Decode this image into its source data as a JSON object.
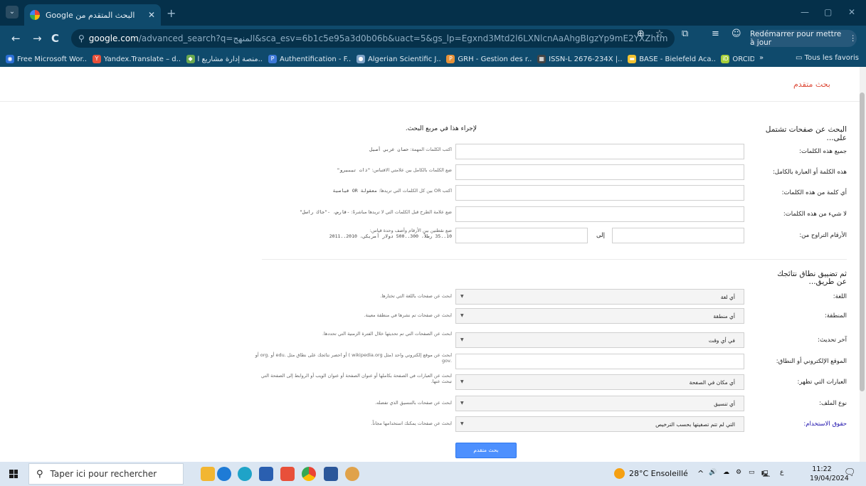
{
  "browser": {
    "tab_title": "البحث المتقدم من Google",
    "tab_close": "✕",
    "new_tab": "+",
    "window_controls": {
      "minimize": "—",
      "maximize": "▢",
      "close": "✕"
    },
    "nav": {
      "back": "←",
      "forward": "→",
      "reload": "C"
    },
    "url_host": "google.com",
    "url_rest": "/advanced_search?q=المنهج&sca_esv=6b1c5e95a3d0b06b&uact=5&gs_lp=Egxnd3Mtd2l6LXNlcnAaAhgBIgzYp9mE2YXZhtmH2KwyChAAGIAE...",
    "restart_label": "Redémarrer pour mettre à jour",
    "more": "⋮",
    "bookmarks": [
      {
        "label": "Free Microsoft Wor...",
        "color": "#2b6fd6",
        "glyph": "◉"
      },
      {
        "label": "Yandex.Translate – d...",
        "color": "#e8503a",
        "glyph": "Y"
      },
      {
        "label": "منصة إدارة مشاريع ا...",
        "color": "#6aa84f",
        "glyph": "◆"
      },
      {
        "label": "Authentification - F...",
        "color": "#3c78d8",
        "glyph": "P"
      },
      {
        "label": "Algerian Scientific J...",
        "color": "#7da2c6",
        "glyph": "●"
      },
      {
        "label": "GRH - Gestion des r...",
        "color": "#e69138",
        "glyph": "P"
      },
      {
        "label": "ISSN-L 2676-234X |...",
        "color": "#444444",
        "glyph": "▦"
      },
      {
        "label": "BASE - Bielefeld Aca...",
        "color": "#f1c232",
        "glyph": "▬"
      },
      {
        "label": "ORCID",
        "color": "#a6ce39",
        "glyph": "iD"
      }
    ],
    "bookmarks_more": "»",
    "all_bookmarks": "Tous les favoris"
  },
  "page": {
    "header": "بحث متقدم",
    "section1": {
      "title": "البحث عن صفحات تشتمل على...",
      "hint": "لإجراء هذا في مربع البحث."
    },
    "rows": [
      {
        "label": "جميع هذه الكلمات:",
        "hint": "اكتب الكلمات المهمة:",
        "example": "حصان عربي أصيل",
        "type": "text"
      },
      {
        "label": "هذه الكلمة أو العبارة بالكامل:",
        "hint": "ضع الكلمات بالكامل بين علامتي الاقتباس:",
        "example": "\"ذات تيبيرو\"",
        "type": "text"
      },
      {
        "label": "أي كلمة من هذه الكلمات:",
        "hint": "اكتب OR بين كل الكلمات التي تريدها:",
        "example": "معقولة OR قياسية",
        "type": "text"
      },
      {
        "label": "لا شيء من هذه الكلمات:",
        "hint": "ضع علامة الطرح قبل الكلمات التي لا تريدها مباشرةً:",
        "example": "-قارض، -\"جاك راسل\"",
        "type": "text"
      },
      {
        "label": "الأرقام التراوح من:",
        "hint": "ضع نقطتين بين الأرقام وأضف وحدة قياس:",
        "example": "10..35 رطلاً، 300..500 دولار أمريكي، 2010..2011",
        "type": "range",
        "to_label": "إلى"
      }
    ],
    "section2": {
      "title": "ثم تضييق نطاق نتائجك عن طريق..."
    },
    "filters": [
      {
        "label": "اللغة:",
        "value": "أي لغة",
        "hint": "ابحث عن صفحات باللغة التي تختارها.",
        "type": "select"
      },
      {
        "label": "المنطقة:",
        "value": "أي منطقة",
        "hint": "ابحث عن صفحات تم نشرها في منطقة معينة.",
        "type": "select"
      },
      {
        "label": "آخر تحديث:",
        "value": "في أي وقت",
        "hint": "ابحث عن الصفحات التي تم تحديثها خلال الفترة الزمنية التي تحددها.",
        "type": "select"
      },
      {
        "label": "الموقع الإلكتروني أو النطاق:",
        "value": "",
        "hint": "ابحث عن موقع إلكتروني واحد (مثل wikipedia.org ) أو احصر نتائجك على نطاق مثل .edu أو .org أو .gov",
        "type": "text"
      },
      {
        "label": "العبارات التي تظهر:",
        "value": "أي مكان في الصفحة",
        "hint": "ابحث عن العبارات في الصفحة بكاملها أو عنوان الصفحة أو عنوان الويب أو الروابط إلى الصفحة التي تبحث عنها.",
        "type": "select"
      },
      {
        "label": "نوع الملف:",
        "value": "أي تنسيق",
        "hint": "ابحث عن صفحات بالتنسيق الذي تفضله.",
        "type": "select"
      },
      {
        "label": "حقوق الاستخدام:",
        "value": "التي لم تتم تصفيتها بحسب الترخيص",
        "hint": "ابحث عن صفحات يمكنك استخدامها مجاناً.",
        "type": "select",
        "link": true
      }
    ],
    "submit_label": "بحث متقدم"
  },
  "taskbar": {
    "search_placeholder": "Taper ici pour rechercher",
    "weather": "28°C Ensoleillé",
    "time": "11:22",
    "date": "19/04/2024",
    "tray_icons": [
      "^",
      "🔊",
      "☁",
      "⚙",
      "▭",
      "🖳",
      "ع"
    ],
    "notification": "🗨"
  }
}
